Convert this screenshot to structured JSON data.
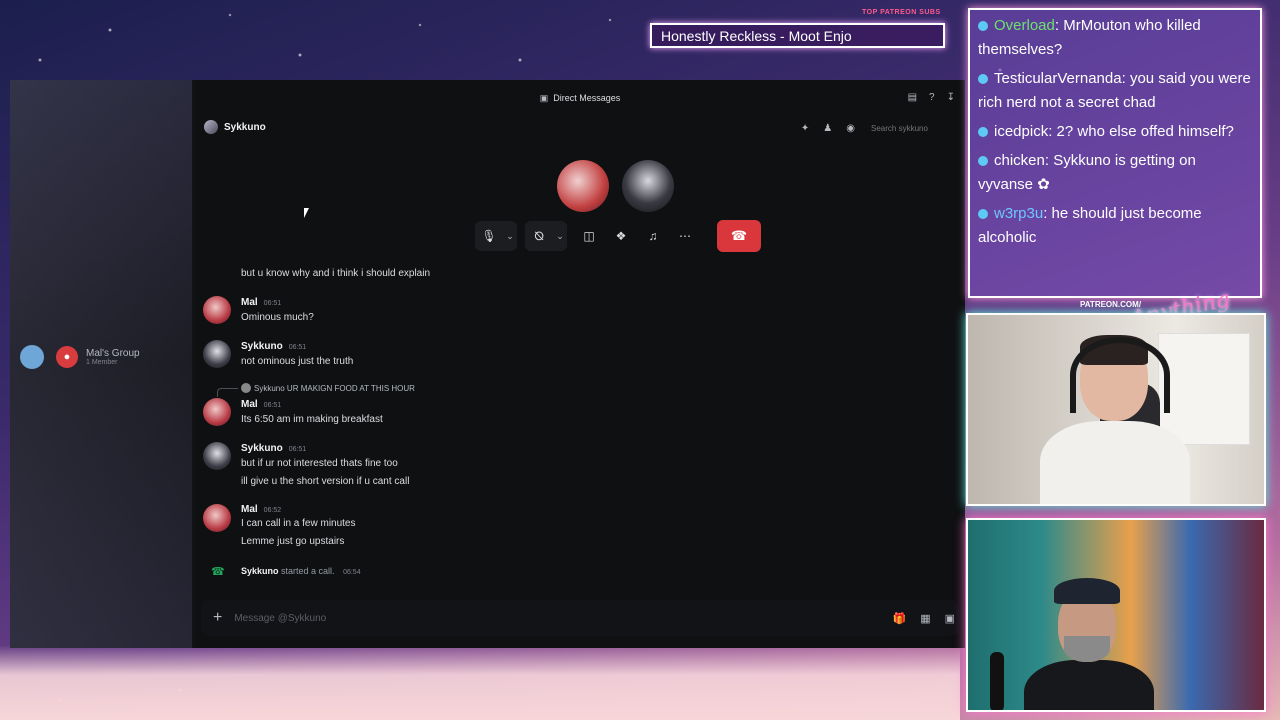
{
  "overlay": {
    "patreon_label": "TOP PATREON SUBS",
    "marquee_text": "Honestly Reckless - Moot Enjo",
    "patreon_site": "PATREON.COM/",
    "brand_script": "Anything Else?"
  },
  "discord": {
    "window_title": "Direct Messages",
    "channel_name": "Sykkuno",
    "search_placeholder": "Search sykkuno",
    "sidebar_group": {
      "name": "Mal's Group",
      "members": "1 Member"
    },
    "messages": [
      {
        "type": "continuation",
        "text": "but u know why and i think i should explain"
      },
      {
        "author": "Mal",
        "time": "06:51",
        "lines": [
          "Ominous much?"
        ]
      },
      {
        "author": "Sykkuno",
        "time": "06:51",
        "lines": [
          "not ominous just the truth"
        ]
      },
      {
        "author": "Mal",
        "time": "06:51",
        "reply_to": "Sykkuno",
        "reply_text": "UR MAKIGN FOOD AT THIS HOUR",
        "lines": [
          "Its 6:50 am im making breakfast"
        ]
      },
      {
        "author": "Sykkuno",
        "time": "06:51",
        "lines": [
          "but if ur not interested thats fine too",
          "ill give u the short version if u cant call"
        ]
      },
      {
        "author": "Mal",
        "time": "06:52",
        "lines": [
          "I can call in a few minutes",
          "Lemme just go upstairs"
        ]
      }
    ],
    "system_message": {
      "author": "Sykkuno",
      "text": "started a call.",
      "time": "06:54"
    },
    "composer_placeholder": "Message @Sykkuno"
  },
  "chat": [
    {
      "user": "Overload",
      "text": "MrMouton who killed themselves?",
      "color": "#6fe06f"
    },
    {
      "user": "TesticularVernanda",
      "text": "you said you were rich nerd not a secret chad",
      "color": "#ffffff"
    },
    {
      "user": "icedpick",
      "text": "2? who else offed himself?",
      "color": "#ffffff"
    },
    {
      "user": "chicken",
      "text": "Sykkuno is getting on vyvanse",
      "color": "#ffffff"
    },
    {
      "user": "w3rp3u",
      "text": "he should just become alcoholic",
      "color": "#6ec6ff"
    }
  ],
  "icons": [
    "discord-logo-icon",
    "inbox-icon",
    "help-icon",
    "download-icon",
    "pin-icon",
    "add-friend-icon",
    "profile-icon",
    "mic-icon",
    "camera-off-icon",
    "screen-share-icon",
    "activities-icon",
    "soundboard-icon",
    "more-icon",
    "hangup-icon",
    "plus-icon",
    "gift-icon",
    "gif-icon",
    "sticker-icon"
  ],
  "colors": {
    "discord_bg": "#111214",
    "hangup_red": "#da373c",
    "call_green": "#23a55a",
    "chat_frame_glow": "#ff9de0",
    "cam1_glow": "#5ff0e0",
    "cam2_glow": "#ff7ad0"
  }
}
